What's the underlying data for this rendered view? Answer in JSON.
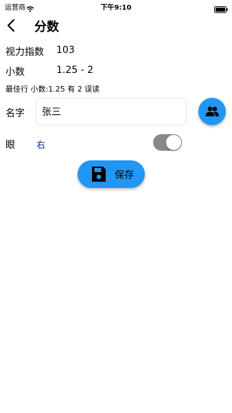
{
  "status_bar": {
    "carrier": "运营商",
    "time": "下午9:10"
  },
  "header": {
    "title": "分数"
  },
  "vision_index": {
    "label": "视力指数",
    "value": "103"
  },
  "decimal": {
    "label": "小数",
    "value": "1.25 - 2"
  },
  "best_line": "最佳行 小数:1.25 有 2 误读",
  "name": {
    "label": "名字",
    "value": "张三"
  },
  "eye": {
    "label": "眼",
    "value": "右",
    "toggle_on": true
  },
  "save_button": {
    "label": "保存"
  },
  "colors": {
    "accent": "#2196f3",
    "eye_value": "#0d2a9e",
    "toggle_track": "#888888"
  },
  "icons": [
    "wifi-icon",
    "battery-icon",
    "back-arrow-icon",
    "contacts-icon",
    "floppy-disk-icon"
  ]
}
